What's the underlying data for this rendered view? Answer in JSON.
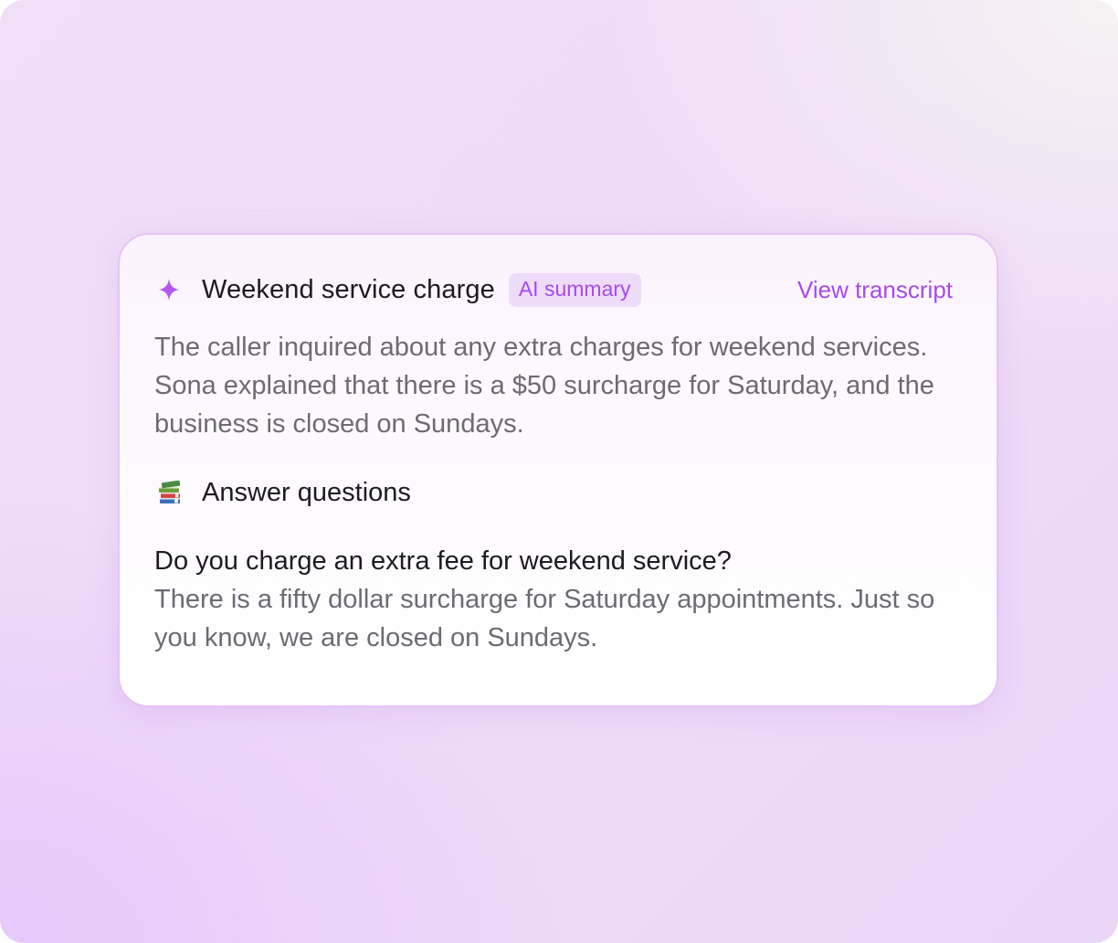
{
  "card": {
    "icon": "sparkle-icon",
    "title": "Weekend service charge",
    "badge": "AI summary",
    "view_link": "View transcript",
    "summary": "The caller inquired about any extra charges for weekend services. Sona explained that there is a $50 surcharge for Saturday, and the business is closed on Sundays.",
    "section": {
      "icon": "books-icon",
      "title": "Answer questions"
    },
    "question": "Do you charge an extra fee for weekend service?",
    "answer": "There is a fifty dollar surcharge for Saturday appointments. Just so you know, we are closed on Sundays."
  },
  "colors": {
    "accent": "#a64bea",
    "badge_bg": "#eedcfb",
    "card_border": "#e7c3f6",
    "heading": "#1d1a22",
    "body_text": "#6e6a72"
  }
}
